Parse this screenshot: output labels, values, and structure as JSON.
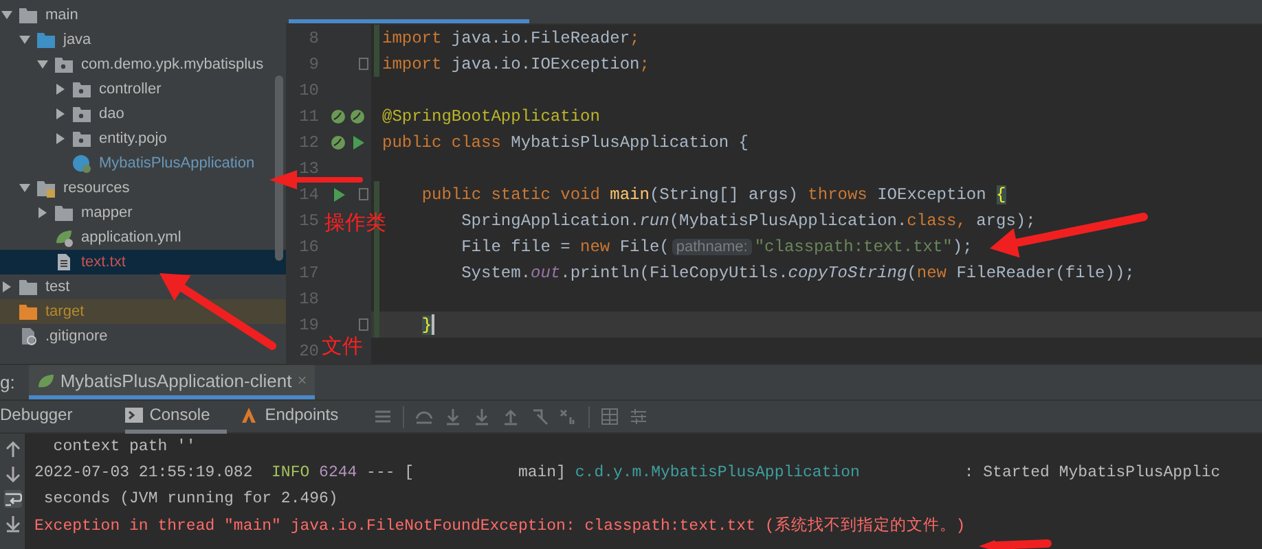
{
  "project_tree": {
    "items": [
      {
        "label": "main",
        "kind": "folder",
        "expanded": true,
        "selected": false,
        "children": [
          {
            "label": "java",
            "kind": "source-folder",
            "expanded": true,
            "selected": false,
            "children": [
              {
                "label": "com.demo.ypk.mybatisplus",
                "kind": "package",
                "expanded": true,
                "selected": false,
                "children": [
                  {
                    "label": "controller",
                    "kind": "package",
                    "expanded": false,
                    "selected": false
                  },
                  {
                    "label": "dao",
                    "kind": "package",
                    "expanded": false,
                    "selected": false
                  },
                  {
                    "label": "entity.pojo",
                    "kind": "package",
                    "expanded": false,
                    "selected": false
                  },
                  {
                    "label": "MybatisPlusApplication",
                    "kind": "spring-class",
                    "selected": false
                  }
                ]
              }
            ]
          },
          {
            "label": "resources",
            "kind": "resources",
            "expanded": true,
            "selected": false,
            "children": [
              {
                "label": "mapper",
                "kind": "folder",
                "expanded": false,
                "selected": false
              },
              {
                "label": "application.yml",
                "kind": "yml",
                "selected": false
              },
              {
                "label": "text.txt",
                "kind": "text",
                "selected": true
              }
            ]
          }
        ]
      },
      {
        "label": "test",
        "kind": "folder",
        "expanded": false,
        "selected": false
      },
      {
        "label": "target",
        "kind": "excluded",
        "selected": false
      },
      {
        "label": ".gitignore",
        "kind": "ignore",
        "selected": false
      }
    ]
  },
  "editor": {
    "lines": [
      {
        "number": "8",
        "changed": true,
        "fold": false,
        "current": false,
        "tokens": [
          {
            "kind": "keyword",
            "text": "import"
          },
          {
            "kind": "plain",
            "text": " java.io.FileReader"
          },
          {
            "kind": "keyword",
            "text": ";"
          }
        ]
      },
      {
        "number": "9",
        "changed": true,
        "fold": true,
        "current": false,
        "tokens": [
          {
            "kind": "keyword",
            "text": "import"
          },
          {
            "kind": "plain",
            "text": " java.io.IOException"
          },
          {
            "kind": "keyword",
            "text": ";"
          }
        ]
      },
      {
        "number": "10",
        "changed": false,
        "fold": false,
        "current": false
      },
      {
        "number": "11",
        "changed": false,
        "fold": false,
        "current": false,
        "markers": [
          {
            "kind": "bean"
          },
          {
            "kind": "bean"
          }
        ],
        "tokens": [
          {
            "kind": "annotation",
            "text": "@SpringBootApplication"
          }
        ]
      },
      {
        "number": "12",
        "changed": false,
        "fold": false,
        "current": false,
        "markers": [
          {
            "kind": "bean"
          },
          {
            "kind": "run"
          }
        ],
        "tokens": [
          {
            "kind": "keyword",
            "text": "public class "
          },
          {
            "kind": "plain",
            "text": "MybatisPlusApplication {"
          }
        ]
      },
      {
        "number": "13",
        "changed": false,
        "fold": false,
        "current": false
      },
      {
        "number": "14",
        "changed": true,
        "fold": true,
        "current": false,
        "markers": [
          {
            "kind": "run"
          }
        ],
        "tokens": [
          {
            "kind": "keyword",
            "text": "    public static void "
          },
          {
            "kind": "method",
            "text": "main"
          },
          {
            "kind": "plain",
            "text": "(String[] args) "
          },
          {
            "kind": "keyword",
            "text": "throws "
          },
          {
            "kind": "plain",
            "text": "IOException "
          },
          {
            "kind": "brace",
            "text": "{"
          }
        ]
      },
      {
        "number": "15",
        "changed": true,
        "fold": false,
        "current": false,
        "tokens": [
          {
            "kind": "plain",
            "text": "        SpringApplication."
          },
          {
            "kind": "italic",
            "text": "run"
          },
          {
            "kind": "plain",
            "text": "(MybatisPlusApplication."
          },
          {
            "kind": "keyword",
            "text": "class, "
          },
          {
            "kind": "plain",
            "text": "args);"
          }
        ]
      },
      {
        "number": "16",
        "changed": true,
        "fold": false,
        "current": false,
        "tokens": [
          {
            "kind": "plain",
            "text": "        File file = "
          },
          {
            "kind": "keyword",
            "text": "new "
          },
          {
            "kind": "plain",
            "text": "File("
          },
          {
            "kind": "hint",
            "text": "pathname:"
          },
          {
            "kind": "string",
            "text": "\"classpath:text.txt\""
          },
          {
            "kind": "plain",
            "text": ");"
          }
        ]
      },
      {
        "number": "17",
        "changed": true,
        "fold": false,
        "current": false,
        "tokens": [
          {
            "kind": "plain",
            "text": "        System."
          },
          {
            "kind": "field",
            "text": "out"
          },
          {
            "kind": "plain",
            "text": ".println(FileCopyUtils."
          },
          {
            "kind": "italic",
            "text": "copyToString"
          },
          {
            "kind": "plain",
            "text": "("
          },
          {
            "kind": "keyword",
            "text": "new "
          },
          {
            "kind": "plain",
            "text": "FileReader(file));"
          }
        ]
      },
      {
        "number": "18",
        "changed": true,
        "fold": false,
        "current": false
      },
      {
        "number": "19",
        "changed": true,
        "fold": true,
        "current": true,
        "tokens": [
          {
            "kind": "brace",
            "text": "    }"
          }
        ]
      },
      {
        "number": "20",
        "changed": false,
        "fold": false,
        "current": false
      }
    ]
  },
  "annotations": {
    "labels": [
      {
        "text": "操作类"
      },
      {
        "text": "文件"
      }
    ]
  },
  "run_panel": {
    "label": "g:",
    "session_tab": {
      "title": "MybatisPlusApplication-client",
      "close": "×"
    },
    "tabs": [
      {
        "label": "Debugger",
        "kind": "plain",
        "selected": false
      },
      {
        "label": "Console",
        "kind": "console",
        "selected": true
      },
      {
        "label": "Endpoints",
        "kind": "endpoints",
        "selected": false
      }
    ],
    "console_lines": [
      {
        "kind": "output",
        "tokens": [
          {
            "kind": "plain",
            "text": "  context path ''"
          }
        ]
      },
      {
        "kind": "output",
        "tokens": [
          {
            "kind": "plain",
            "text": "2022-07-03 21:55:19.082  "
          },
          {
            "kind": "info",
            "text": "INFO"
          },
          {
            "kind": "pid",
            "text": " 6244"
          },
          {
            "kind": "plain",
            "text": " --- [           main] "
          },
          {
            "kind": "logger",
            "text": "c.d.y.m.MybatisPlusApplication"
          },
          {
            "kind": "plain",
            "text": "           : Started MybatisPlusApplic"
          }
        ]
      },
      {
        "kind": "output",
        "tokens": [
          {
            "kind": "plain",
            "text": " seconds (JVM running for 2.496)"
          }
        ]
      },
      {
        "kind": "error",
        "tokens": [
          {
            "kind": "plain",
            "text": "Exception in thread \"main\" java.io.FileNotFoundException: classpath:text.txt (系统找不到指定的文件。)"
          }
        ]
      }
    ]
  }
}
